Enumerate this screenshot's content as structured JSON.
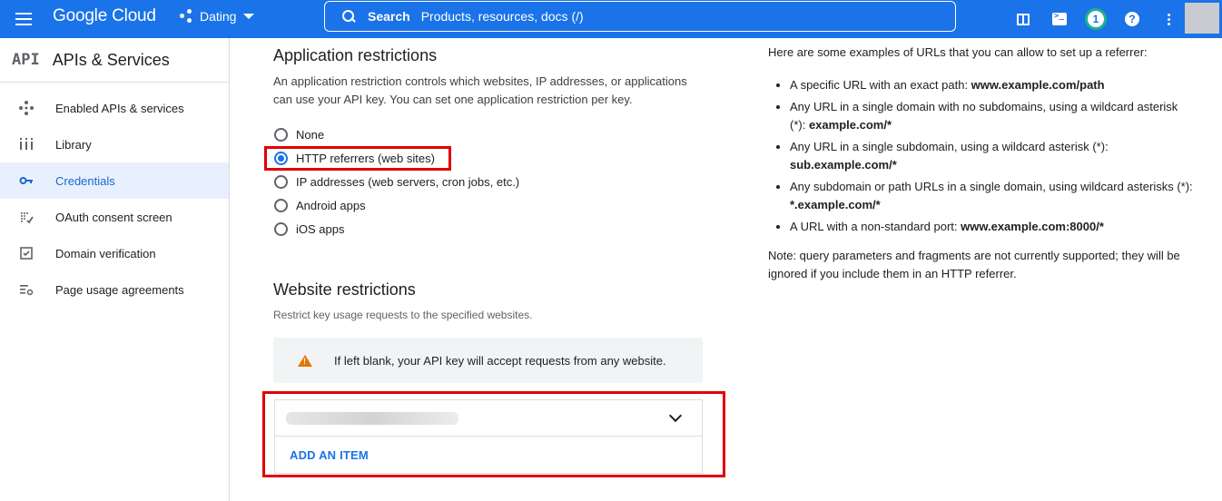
{
  "topbar": {
    "logo": "Google Cloud",
    "project": "Dating",
    "search_label": "Search",
    "search_placeholder": "Products, resources, docs (/)",
    "notification_count": "1",
    "help": "?",
    "colors": {
      "bar": "#1a73e8",
      "badge_ring": "#1db18e"
    }
  },
  "sidebar": {
    "logo_text": "API",
    "title": "APIs & Services",
    "items": [
      {
        "label": "Enabled APIs & services",
        "icon": "diamond-arrows-icon"
      },
      {
        "label": "Library",
        "icon": "library-icon"
      },
      {
        "label": "Credentials",
        "icon": "key-icon",
        "active": true
      },
      {
        "label": "OAuth consent screen",
        "icon": "oauth-icon"
      },
      {
        "label": "Domain verification",
        "icon": "checkbox-icon"
      },
      {
        "label": "Page usage agreements",
        "icon": "settings-list-icon"
      }
    ]
  },
  "main": {
    "app_restrictions": {
      "heading": "Application restrictions",
      "description": "An application restriction controls which websites, IP addresses, or applications can use your API key. You can set one application restriction per key.",
      "options": [
        {
          "label": "None",
          "selected": false
        },
        {
          "label": "HTTP referrers (web sites)",
          "selected": true
        },
        {
          "label": "IP addresses (web servers, cron jobs, etc.)",
          "selected": false
        },
        {
          "label": "Android apps",
          "selected": false
        },
        {
          "label": "iOS apps",
          "selected": false
        }
      ]
    },
    "website_restrictions": {
      "heading": "Website restrictions",
      "description": "Restrict key usage requests to the specified websites.",
      "warning": "If left blank, your API key will accept requests from any website.",
      "add_item": "ADD AN ITEM"
    }
  },
  "help_panel": {
    "intro": "Here are some examples of URLs that you can allow to set up a referrer:",
    "examples": [
      {
        "text": "A specific URL with an exact path: ",
        "bold": "www.example.com/path"
      },
      {
        "text": "Any URL in a single domain with no subdomains, using a wildcard asterisk (*): ",
        "bold": "example.com/*"
      },
      {
        "text": "Any URL in a single subdomain, using a wildcard asterisk (*): ",
        "bold": "sub.example.com/*"
      },
      {
        "text": "Any subdomain or path URLs in a single domain, using wildcard asterisks (*): ",
        "bold": "*.example.com/*"
      },
      {
        "text": "A URL with a non-standard port: ",
        "bold": "www.example.com:8000/*"
      }
    ],
    "note": "Note: query parameters and fragments are not currently supported; they will be ignored if you include them in an HTTP referrer."
  }
}
